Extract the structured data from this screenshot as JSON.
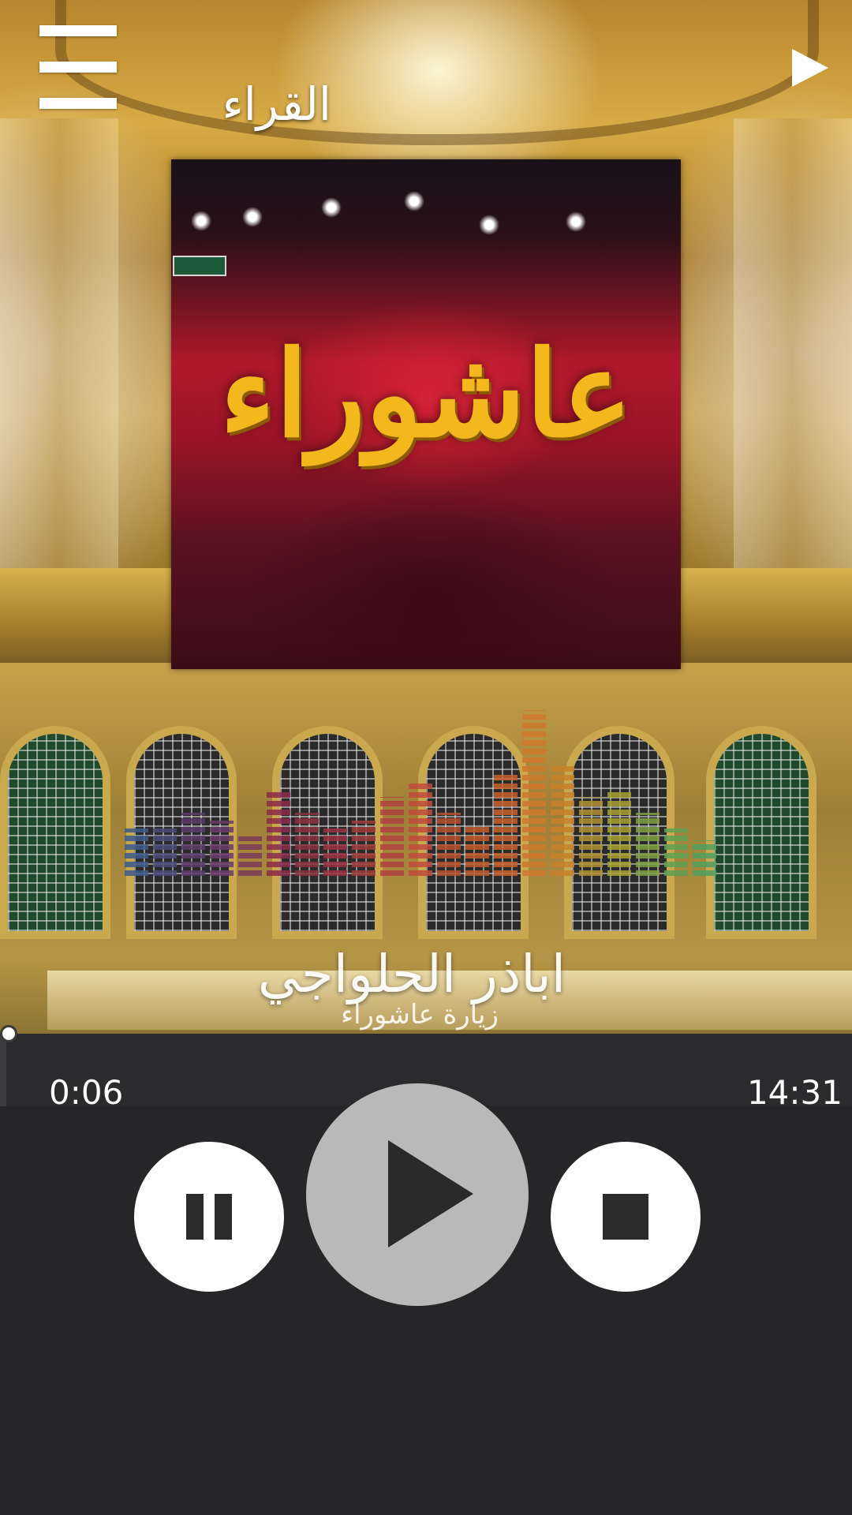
{
  "header": {
    "title": "القراء",
    "menu_icon": "hamburger-menu-icon",
    "share_icon": "share-play-icon"
  },
  "album": {
    "art_text": "عاشوراء",
    "image": "album-cover-ashura"
  },
  "track": {
    "artist": "اباذر الحلواجي",
    "name": "زيارة عاشوراء"
  },
  "player": {
    "elapsed": "0:06",
    "duration": "14:31",
    "progress_fraction": 0.007,
    "pause_icon": "pause-icon",
    "play_icon": "play-icon",
    "stop_icon": "stop-icon"
  },
  "colors": {
    "panel_bg": "#262628",
    "seek_bg": "#2b2b2d",
    "play_button": "#b9b9b9",
    "control_button": "#ffffff",
    "album_title": "#f3b81c"
  }
}
